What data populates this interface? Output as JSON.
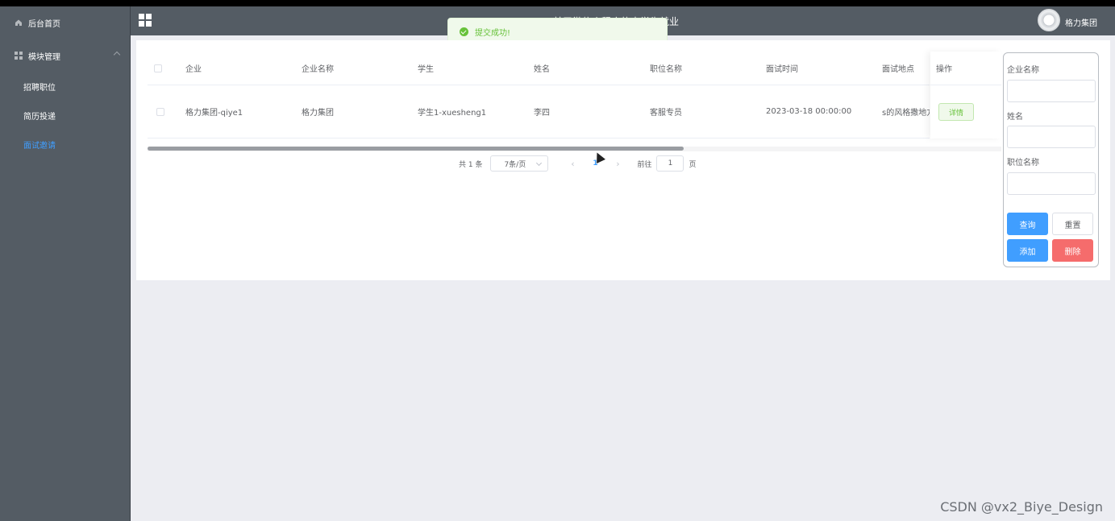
{
  "header": {
    "site_title": "基于微信小程序的大学生就业",
    "user_name": "格力集团"
  },
  "sidebar": {
    "items": [
      {
        "label": "后台首页",
        "icon": "home-icon"
      },
      {
        "label": "模块管理",
        "icon": "grid-icon",
        "expanded": true
      },
      {
        "label": "招聘职位"
      },
      {
        "label": "简历投递"
      },
      {
        "label": "面试邀请",
        "active": true
      }
    ]
  },
  "toast": {
    "message": "提交成功!",
    "color": "#67c23a"
  },
  "table": {
    "columns": [
      "企业",
      "企业名称",
      "学生",
      "姓名",
      "职位名称",
      "面试时间",
      "面试地点",
      "操作"
    ],
    "rows": [
      {
        "qiye": "格力集团-qiye1",
        "qiye_name": "格力集团",
        "student": "学生1-xuesheng1",
        "name": "李四",
        "position": "客服专员",
        "time": "2023-03-18 00:00:00",
        "location": "s的风格撒地方",
        "action": "详情"
      }
    ]
  },
  "pagination": {
    "total_text": "共 1 条",
    "page_size": "7条/页",
    "prev": "‹",
    "current_page": "1",
    "next": "›",
    "goto_label": "前往",
    "goto_value": "1",
    "goto_suffix": "页"
  },
  "search_panel": {
    "field1_label": "企业名称",
    "field2_label": "姓名",
    "field3_label": "职位名称",
    "query_btn": "查询",
    "reset_btn": "重置",
    "add_btn": "添加",
    "delete_btn": "删除"
  },
  "watermark": "CSDN @vx2_Biye_Design",
  "colors": {
    "sidebar_bg": "#545c64",
    "primary": "#409eff",
    "success": "#67c23a",
    "danger": "#f56c6c"
  }
}
